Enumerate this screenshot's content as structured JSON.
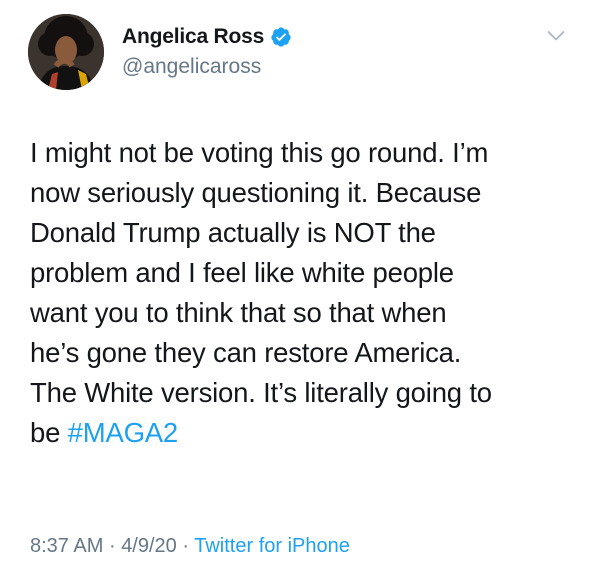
{
  "tweet": {
    "author": {
      "display_name": "Angelica Ross",
      "handle": "@angelicaross",
      "verified": true,
      "avatar_icon": "profile-photo"
    },
    "menu_icon": "chevron-down-icon",
    "text_lines": [
      "I might not be voting this go round.  I’m",
      "now seriously questioning it.  Because",
      "Donald Trump actually is NOT the",
      "problem and I feel like white people",
      "want you to think that so that when",
      "he’s gone they can restore America.",
      "The White version. It’s literally going to"
    ],
    "last_line_prefix": "be ",
    "hashtag": "#MAGA2",
    "time": "8:37 AM",
    "date": "4/9/20",
    "separator": "·",
    "source": "Twitter for iPhone"
  },
  "colors": {
    "text": "#14171a",
    "secondary": "#657786",
    "link": "#1da1f2",
    "background": "#ffffff"
  }
}
